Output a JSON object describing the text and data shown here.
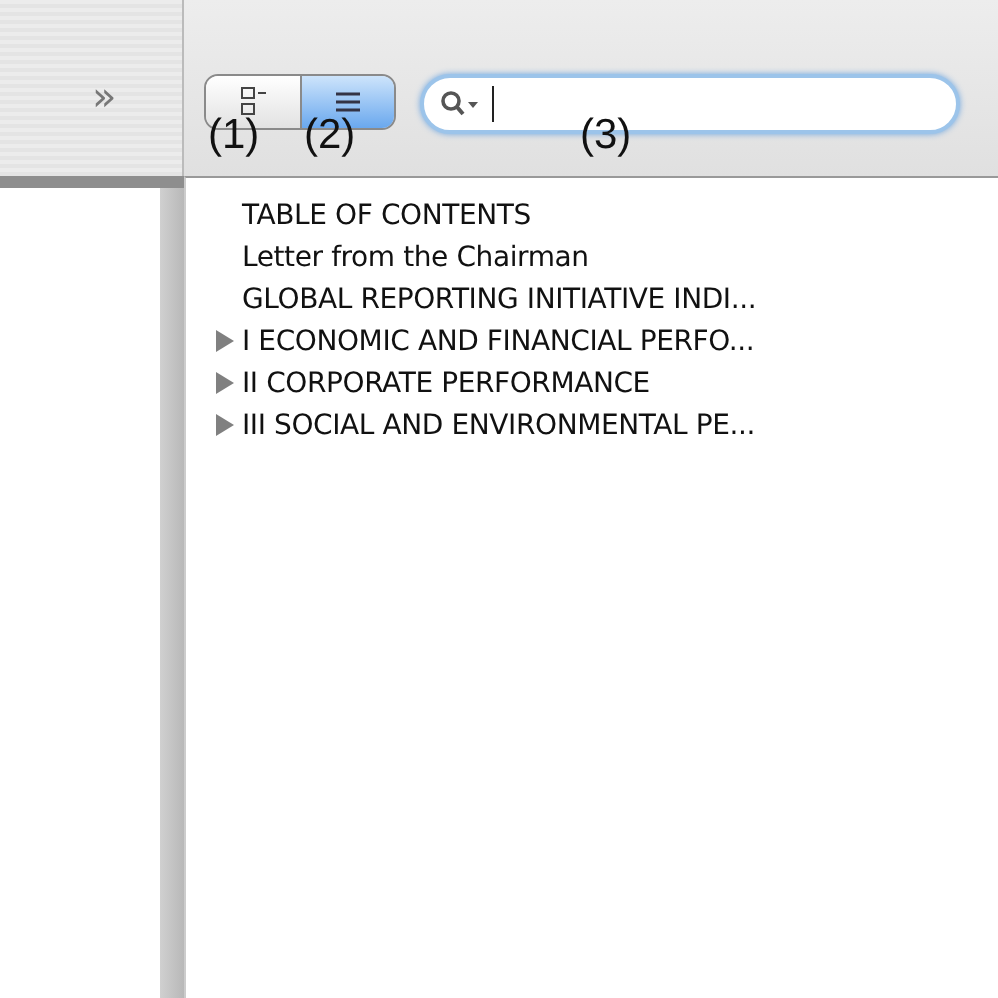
{
  "toolbar": {
    "overflow_glyph": "»",
    "view_buttons": [
      {
        "kind": "thumbnails",
        "selected": false
      },
      {
        "kind": "outline",
        "selected": true
      }
    ],
    "search": {
      "focused": true
    }
  },
  "callouts": [
    "(1)",
    "(2)",
    "(3)"
  ],
  "outline": {
    "items": [
      {
        "label": "TABLE OF CONTENTS",
        "kind": "leaf"
      },
      {
        "label": "Letter from the Chairman",
        "kind": "leaf"
      },
      {
        "label": "GLOBAL REPORTING INITIATIVE INDI...",
        "kind": "leaf"
      },
      {
        "label": "I ECONOMIC AND FINANCIAL PERFO...",
        "kind": "folder",
        "expanded": false
      },
      {
        "label": "II CORPORATE PERFORMANCE",
        "kind": "folder",
        "expanded": false
      },
      {
        "label": "III SOCIAL AND ENVIRONMENTAL PE...",
        "kind": "folder",
        "expanded": false
      }
    ]
  }
}
